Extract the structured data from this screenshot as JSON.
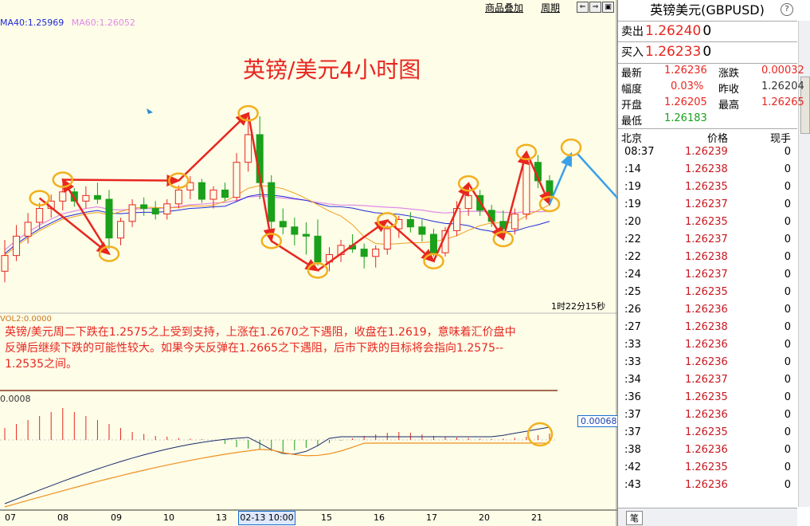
{
  "toolbar": {
    "overlay_label": "商品叠加",
    "period_label": "周期",
    "nav_buttons": [
      "⇐",
      "⇒",
      "▣"
    ]
  },
  "indicators": {
    "ma40": "MA40:1.25969",
    "ma60": "MA60:1.26052",
    "vol": "VOL2:0.0000",
    "macd_top": "0.0008",
    "macd_value": "0.00068",
    "ma40_color": "#1e2ad8",
    "ma60_color": "#e08ae6"
  },
  "chart": {
    "title": "英镑/美元4小时图",
    "timer": "1时22分15秒",
    "highlight_date": "02-13 10:00",
    "x_labels": [
      "07",
      "08",
      "09",
      "10",
      "13",
      "15",
      "16",
      "17",
      "20",
      "21"
    ],
    "comment_lines": [
      "英镑/美元周二下跌在1.2575之上受到支持，上涨在1.2670之下遇阻，收盘在1.2619，意味着汇价盘中",
      "反弹后继续下跌的可能性较大。如果今天反弹在1.2665之下遇阻，后市下跌的目标将会指向1.2575--",
      "1.2535之间。"
    ],
    "up_color": "#e8261f",
    "down_color": "#1aa01a",
    "ring_color": "#f2b01e",
    "arrow_red": "#e8261f",
    "arrow_blue": "#3aa0e8"
  },
  "chart_data": {
    "type": "candlestick",
    "x_labels": [
      "07",
      "08",
      "09",
      "10",
      "13",
      "15",
      "16",
      "17",
      "20",
      "21"
    ],
    "ma_series": [
      {
        "name": "MA40",
        "last": 1.25969
      },
      {
        "name": "MA60",
        "last": 1.26052
      }
    ],
    "candles": [
      [
        1.2572,
        1.2606,
        1.256,
        1.2589
      ],
      [
        1.2589,
        1.2622,
        1.2583,
        1.261
      ],
      [
        1.261,
        1.2635,
        1.2602,
        1.2625
      ],
      [
        1.2625,
        1.2646,
        1.2618,
        1.264
      ],
      [
        1.264,
        1.2655,
        1.263,
        1.2648
      ],
      [
        1.2648,
        1.2666,
        1.2638,
        1.2658
      ],
      [
        1.2658,
        1.2662,
        1.2642,
        1.2648
      ],
      [
        1.2648,
        1.2664,
        1.264,
        1.2654
      ],
      [
        1.2654,
        1.2668,
        1.2645,
        1.265
      ],
      [
        1.265,
        1.266,
        1.2596,
        1.2608
      ],
      [
        1.2608,
        1.263,
        1.26,
        1.2626
      ],
      [
        1.2626,
        1.265,
        1.262,
        1.2644
      ],
      [
        1.2644,
        1.2652,
        1.2632,
        1.264
      ],
      [
        1.264,
        1.2648,
        1.2628,
        1.2634
      ],
      [
        1.2634,
        1.265,
        1.2628,
        1.2645
      ],
      [
        1.2645,
        1.2665,
        1.264,
        1.266
      ],
      [
        1.266,
        1.2675,
        1.265,
        1.2668
      ],
      [
        1.2668,
        1.2672,
        1.2646,
        1.265
      ],
      [
        1.265,
        1.2664,
        1.264,
        1.266
      ],
      [
        1.266,
        1.2668,
        1.2648,
        1.2652
      ],
      [
        1.2652,
        1.27,
        1.2648,
        1.269
      ],
      [
        1.269,
        1.2738,
        1.268,
        1.272
      ],
      [
        1.272,
        1.274,
        1.265,
        1.2668
      ],
      [
        1.2668,
        1.2676,
        1.261,
        1.2626
      ],
      [
        1.2626,
        1.264,
        1.2612,
        1.262
      ],
      [
        1.262,
        1.263,
        1.26,
        1.2612
      ],
      [
        1.2612,
        1.2625,
        1.259,
        1.261
      ],
      [
        1.261,
        1.2628,
        1.2578,
        1.2582
      ],
      [
        1.2582,
        1.2598,
        1.2572,
        1.259
      ],
      [
        1.259,
        1.2606,
        1.2582,
        1.26
      ],
      [
        1.26,
        1.2612,
        1.2592,
        1.2596
      ],
      [
        1.2596,
        1.2602,
        1.2575,
        1.2588
      ],
      [
        1.2588,
        1.26,
        1.2576,
        1.2596
      ],
      [
        1.2596,
        1.2622,
        1.259,
        1.2618
      ],
      [
        1.2618,
        1.2632,
        1.2608,
        1.2628
      ],
      [
        1.2628,
        1.2636,
        1.2614,
        1.262
      ],
      [
        1.262,
        1.2628,
        1.2604,
        1.2612
      ],
      [
        1.2612,
        1.2618,
        1.2588,
        1.2592
      ],
      [
        1.2592,
        1.262,
        1.2588,
        1.2616
      ],
      [
        1.2616,
        1.2648,
        1.261,
        1.264
      ],
      [
        1.264,
        1.2662,
        1.2632,
        1.2654
      ],
      [
        1.2654,
        1.266,
        1.2632,
        1.2638
      ],
      [
        1.2638,
        1.2644,
        1.262,
        1.2626
      ],
      [
        1.2626,
        1.2638,
        1.2612,
        1.2618
      ],
      [
        1.2618,
        1.264,
        1.2612,
        1.2634
      ],
      [
        1.2634,
        1.2696,
        1.2628,
        1.269
      ],
      [
        1.269,
        1.2698,
        1.2662,
        1.267
      ],
      [
        1.267,
        1.2676,
        1.265,
        1.2654
      ]
    ],
    "macd_hist": [
      0.0003,
      0.0004,
      0.0005,
      0.0006,
      0.0007,
      0.0008,
      0.0007,
      0.0006,
      0.0005,
      0.0004,
      0.0003,
      0.0002,
      0.00015,
      0.0001,
      8e-05,
      5e-05,
      3e-05,
      2e-05,
      0.0,
      -0.0001,
      -0.00018,
      -0.00022,
      -0.00025,
      -0.00028,
      -0.0003,
      -0.00026,
      -0.0002,
      -0.00014,
      -8e-05,
      -2e-05,
      4e-05,
      0.0001,
      0.00014,
      0.00018,
      0.0002,
      0.00018,
      0.00014,
      0.0001,
      8e-05,
      6e-05,
      5e-05,
      3e-05,
      2e-05,
      3e-05,
      5e-05,
      8e-05,
      0.00012,
      0.00016
    ]
  },
  "quote": {
    "name": "英镑美元(GBPUSD)",
    "help": "?",
    "sell_label": "卖出",
    "sell_price": "1.26240",
    "sell_vol": "0",
    "buy_label": "买入",
    "buy_price": "1.26233",
    "buy_vol": "0",
    "stats": [
      {
        "l1": "最新",
        "v1": "1.26236",
        "l2": "涨跌",
        "v2": "0.00032"
      },
      {
        "l1": "幅度",
        "v1": "0.03%",
        "l2": "昨收",
        "v2": "1.26204"
      },
      {
        "l1": "开盘",
        "v1": "1.26205",
        "l2": "最高",
        "v2": "1.26265"
      },
      {
        "l1": "最低",
        "v1": "1.26183",
        "l2": "",
        "v2": ""
      }
    ],
    "tick_headers": [
      "北京",
      "价格",
      "现手"
    ],
    "ticks": [
      {
        "t": "08:37",
        "p": "1.26239",
        "v": "0"
      },
      {
        "t": ":14",
        "p": "1.26238",
        "v": "0"
      },
      {
        "t": ":19",
        "p": "1.26235",
        "v": "0"
      },
      {
        "t": ":19",
        "p": "1.26237",
        "v": "0"
      },
      {
        "t": ":20",
        "p": "1.26235",
        "v": "0"
      },
      {
        "t": ":22",
        "p": "1.26237",
        "v": "0"
      },
      {
        "t": ":22",
        "p": "1.26238",
        "v": "0"
      },
      {
        "t": ":24",
        "p": "1.26237",
        "v": "0"
      },
      {
        "t": ":25",
        "p": "1.26235",
        "v": "0"
      },
      {
        "t": ":26",
        "p": "1.26236",
        "v": "0"
      },
      {
        "t": ":27",
        "p": "1.26238",
        "v": "0"
      },
      {
        "t": ":33",
        "p": "1.26236",
        "v": "0"
      },
      {
        "t": ":33",
        "p": "1.26236",
        "v": "0"
      },
      {
        "t": ":34",
        "p": "1.26237",
        "v": "0"
      },
      {
        "t": ":36",
        "p": "1.26235",
        "v": "0"
      },
      {
        "t": ":37",
        "p": "1.26236",
        "v": "0"
      },
      {
        "t": ":37",
        "p": "1.26235",
        "v": "0"
      },
      {
        "t": ":38",
        "p": "1.26236",
        "v": "0"
      },
      {
        "t": ":42",
        "p": "1.26235",
        "v": "0"
      },
      {
        "t": ":43",
        "p": "1.26236",
        "v": "0"
      }
    ],
    "bottom_tab": "笔"
  }
}
